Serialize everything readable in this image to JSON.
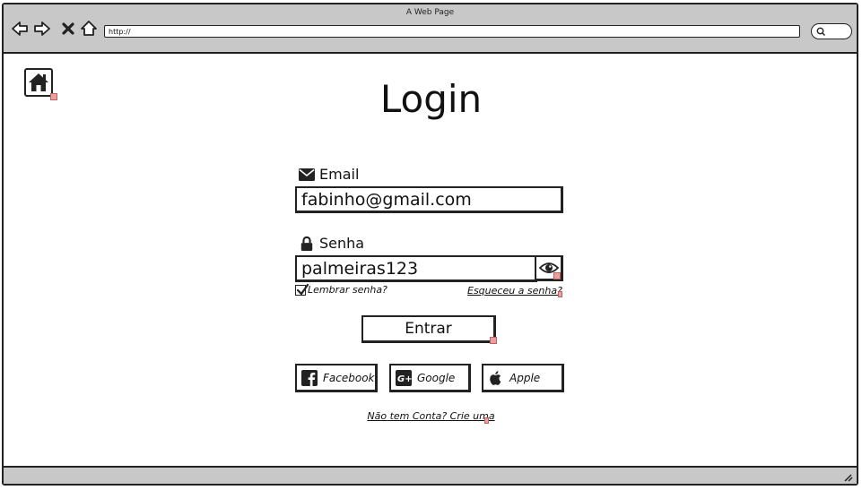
{
  "window": {
    "title": "A Web Page",
    "url": "http://"
  },
  "icons": {
    "back": "arrow-left-icon",
    "forward": "arrow-right-icon",
    "stop": "close-icon",
    "home_nav": "home-outline-icon",
    "search": "search-icon",
    "home": "home-icon",
    "email": "envelope-icon",
    "lock": "lock-icon",
    "eye": "eye-icon",
    "facebook": "facebook-icon",
    "google": "google-plus-icon",
    "apple": "apple-icon"
  },
  "page": {
    "title": "Login"
  },
  "form": {
    "email_label": "Email",
    "email_value": "fabinho@gmail.com",
    "password_label": "Senha",
    "password_value": "palmeiras123",
    "remember_label": "Lembrar senha?",
    "remember_checked": true,
    "forgot_link": "Esqueceu a senha?",
    "submit_label": "Entrar"
  },
  "social": {
    "facebook": "Facebook",
    "google": "Google",
    "apple": "Apple"
  },
  "footer": {
    "signup_link": "Não tem Conta? Crie uma"
  }
}
